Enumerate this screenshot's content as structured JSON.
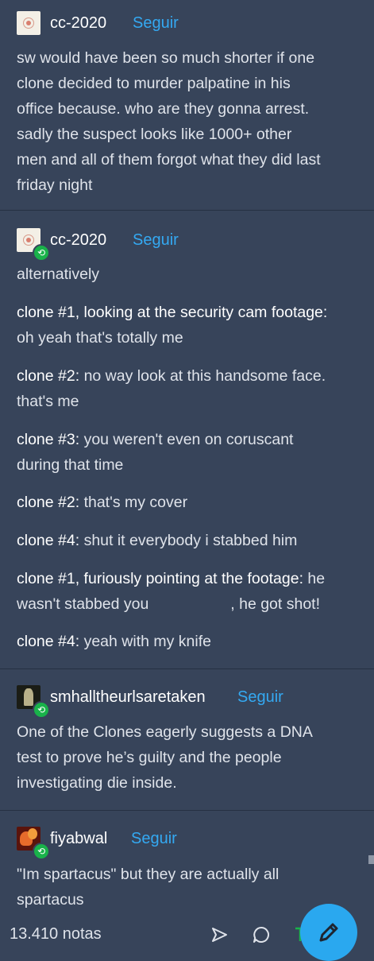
{
  "posts": [
    {
      "username": "cc-2020",
      "follow_label": "Seguir",
      "avatar_icon": "atom-avatar-icon",
      "lines": [
        "sw would have been so much shorter if one",
        "clone decided to murder palpatine in his",
        "office because. who are they gonna arrest.",
        "sadly the suspect looks like 1000+ other",
        "men and all of them forgot what they did last",
        "friday night"
      ]
    },
    {
      "username": "cc-2020",
      "follow_label": "Seguir",
      "intro": "alternatively",
      "dialogue": [
        {
          "speaker": "clone #1, looking at the security cam footage:",
          "line1": "",
          "line2": "oh yeah that's totally me"
        },
        {
          "speaker": "clone #2:",
          "line1": " no way look at this handsome face.",
          "line2": "that's me"
        },
        {
          "speaker": "clone #3:",
          "line1": " you weren't even on coruscant",
          "line2": "during that time"
        },
        {
          "speaker": "clone #2:",
          "line1": " that's my cover",
          "line2": ""
        },
        {
          "speaker": "clone #4:",
          "line1": " shut it everybody i stabbed him",
          "line2": ""
        },
        {
          "speaker": "clone #1, furiously pointing at the footage:",
          "line1": " he",
          "line2": "wasn't stabbed you                   , he got shot!"
        },
        {
          "speaker": "clone #4:",
          "line1": " yeah with my knife",
          "line2": ""
        }
      ]
    },
    {
      "username": "smhalltheurlsaretaken",
      "follow_label": "Seguir",
      "lines": [
        "One of the Clones eagerly suggests a DNA",
        "test to prove he’s guilty and the people",
        "investigating die inside."
      ]
    },
    {
      "username": "fiyabwal",
      "follow_label": "Seguir",
      "lines": [
        "\"Im spartacus\" but they are actually all",
        "spartacus"
      ]
    }
  ],
  "footer": {
    "notes": "13.410 notas",
    "share_icon": "share-icon",
    "reply_icon": "reply-icon",
    "reblog_icon": "reblog-icon",
    "compose_icon": "pencil-icon"
  },
  "colors": {
    "background": "#37445a",
    "accent": "#34a9f2",
    "reblog_badge": "#19b24a",
    "fab": "#2aa8ef"
  }
}
